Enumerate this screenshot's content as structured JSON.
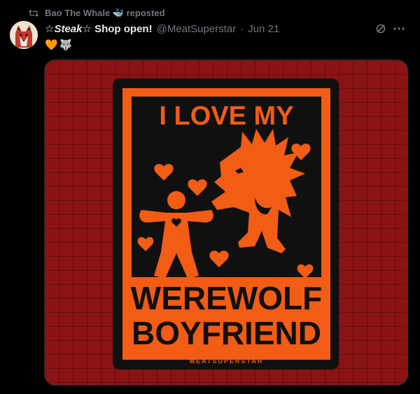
{
  "repost": {
    "user": "Bao The Whale",
    "user_emoji": "🐳",
    "label": "reposted"
  },
  "post": {
    "author_prefix_star": "☆",
    "author_steak": "Steak",
    "author_suffix_star": "☆",
    "author_rest": " Shop open!",
    "handle": "@MeatSuperstar",
    "separator": "·",
    "date": "Jun 21",
    "emoji_line": [
      "🧡",
      "🐺"
    ]
  },
  "image": {
    "line1": "I LOVE MY",
    "line2": "WEREWOLF",
    "line3": "BOYFRIEND",
    "brand": "MEATSUPERSTAR"
  },
  "colors": {
    "accent_orange": "#f25c14",
    "sticker_black": "#101010",
    "background_red": "#8a1414",
    "muted": "#71767b"
  },
  "icons": {
    "repost": "repost-icon",
    "grok": "grok-icon",
    "more": "more-icon"
  }
}
